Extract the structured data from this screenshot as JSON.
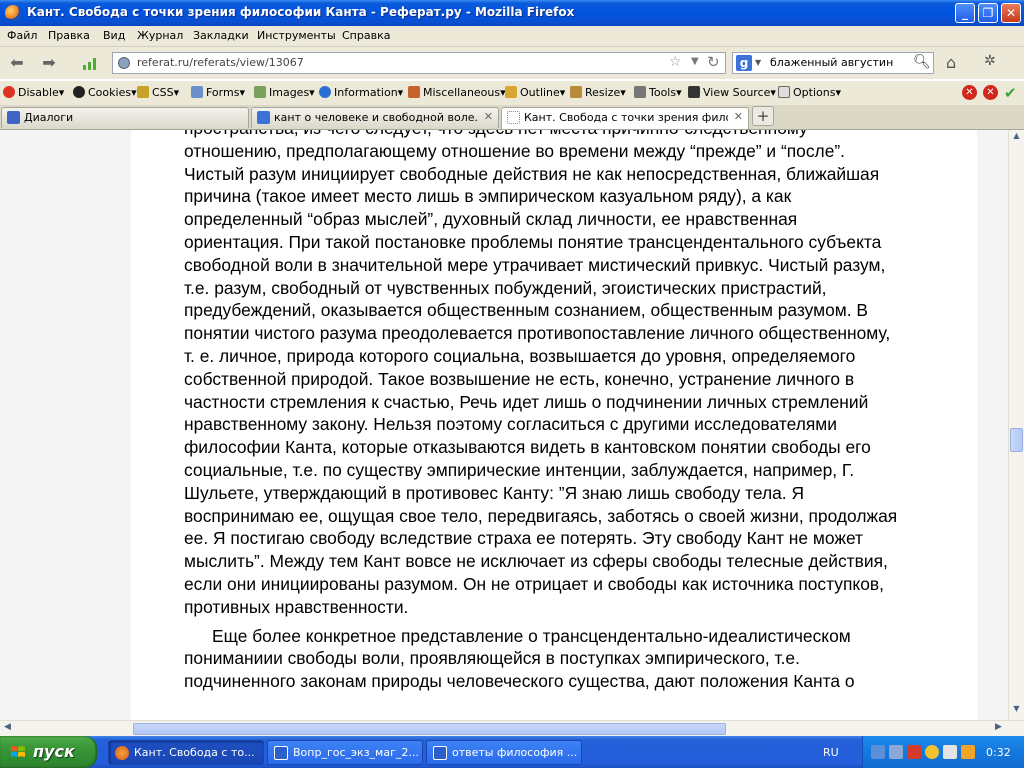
{
  "window": {
    "title": "Кант. Свобода с точки зрения философии Канта - Реферат.ру - Mozilla Firefox",
    "minimize": "_",
    "maximize": "❐",
    "close": "✕"
  },
  "menu": [
    "Файл",
    "Правка",
    "Вид",
    "Журнал",
    "Закладки",
    "Инструменты",
    "Справка"
  ],
  "nav": {
    "url": "referat.ru/referats/view/13067",
    "search_engine": "g",
    "search_query": "блаженный августин"
  },
  "devtoolbar": [
    "Disable▾",
    "Cookies▾",
    "CSS▾",
    "Forms▾",
    "Images▾",
    "Information▾",
    "Miscellaneous▾",
    "Outline▾",
    "Resize▾",
    "Tools▾",
    "View Source▾",
    "Options▾"
  ],
  "tabs": [
    {
      "label": "Диалоги"
    },
    {
      "label": "кант о человеке и свободной воле. - П..."
    },
    {
      "label": "Кант. Свобода с точки зрения философ..."
    }
  ],
  "newtab_label": "+",
  "article": {
    "p1_lines": [
      "пространства, из чего следует, что здесь нет места  причинно-следственному",
      "отношению, предполагающему отношение во времени между “прежде” и “после”.",
      "Чистый разум инициирует свободные действия не как непосредственная, ближайшая",
      "причина (такое имеет место лишь в эмпирическом казуальном ряду), а как",
      "определенный “образ мыслей”, духовный склад личности, ее нравственная",
      "ориентация. При такой постановке проблемы понятие трансцендентального субъекта",
      "свободной воли в значительной мере утрачивает мистический привкус. Чистый разум,",
      "т.е. разум, свободный от чувственных побуждений, эгоистических пристрастий,",
      "предубеждений, оказывается общественным сознанием, общественным разумом. В",
      "понятии чистого разума преодолевается противопоставление личного общественному,",
      "т. е. личное, природа которого социальна, возвышается до уровня, определяемого",
      "собственной природой. Такое возвышение не есть, конечно, устранение  личного в",
      "частности стремления к счастью, Речь идет лишь о подчинении личных стремлений",
      "нравственному закону.  Нельзя поэтому согласиться с другими исследователями",
      "философии Канта, которые отказываются видеть в кантовском понятии свободы его",
      "социальные, т.е. по существу эмпирические интенции, заблуждается, например, Г.",
      "Шульете, утверждающий в противовес Канту: ”Я знаю лишь свободу тела. Я",
      "воспринимаю ее, ощущая свое тело, передвигаясь, заботясь о своей жизни, продолжая",
      "ее. Я постигаю свободу  вследствие страха ее потерять. Эту свободу Кант не может",
      "мыслить”. Между тем Кант вовсе не исключает из сферы свободы телесные действия,",
      "если они инициированы разумом. Он не отрицает и свободы как источника поступков,",
      "противных нравственности."
    ],
    "p2_lines": [
      "Еще более конкретное представление о трансцендентально-идеалистическом",
      "пониманиии свободы воли, проявляющейся в поступках эмпирического, т.е.",
      "подчиненного законам природы человеческого существа, дают положения Канта о"
    ]
  },
  "taskbar": {
    "start": "пуск",
    "tasks": [
      {
        "label": "Кант. Свобода с то...",
        "active": true
      },
      {
        "label": "Вопр_гос_экз_маг_2...",
        "active": false
      },
      {
        "label": "ответы философия ...",
        "active": false
      }
    ],
    "language": "RU",
    "clock": "0:32"
  }
}
